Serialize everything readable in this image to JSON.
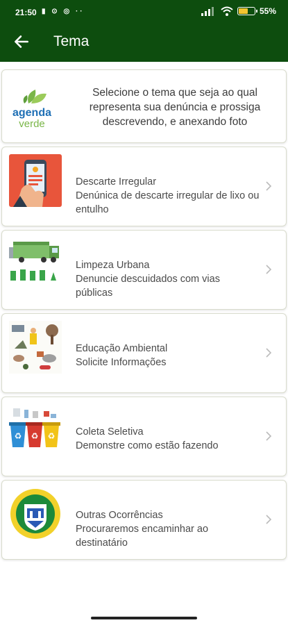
{
  "status_bar": {
    "time": "21:50",
    "notification_icons": "▮ ⊙ ◎ ··",
    "battery_level": "55",
    "battery_suffix": "%"
  },
  "app_bar": {
    "title": "Tema",
    "back_icon": "arrow-left-icon"
  },
  "intro": {
    "logo_text_line1": "agenda",
    "logo_text_line2": "verde",
    "text": "Selecione o tema que seja ao qual representa sua denúncia e prossiga descrevendo, e anexando foto"
  },
  "themes": [
    {
      "title": "Descarte Irregular",
      "description": "Denúnica de descarte irregular de lixo ou entulho",
      "icon": "phone-hand-icon"
    },
    {
      "title": "Limpeza Urbana",
      "description": "Denuncie descuidados com vias públicas",
      "icon": "garbage-truck-icon"
    },
    {
      "title": "Educação Ambiental",
      "description": "Solicite Informações",
      "icon": "environment-education-icon"
    },
    {
      "title": "Coleta Seletiva",
      "description": "Demonstre como estão fazendo",
      "icon": "recycle-bins-icon"
    },
    {
      "title": "Outras Ocorrências",
      "description": "Procuraremos encaminhar ao destinatário",
      "icon": "city-seal-icon"
    }
  ],
  "colors": {
    "primary": "#0d4d0e",
    "card_border": "#d9dccd",
    "logo_blue": "#1e6fb5",
    "logo_green": "#7ab648"
  }
}
